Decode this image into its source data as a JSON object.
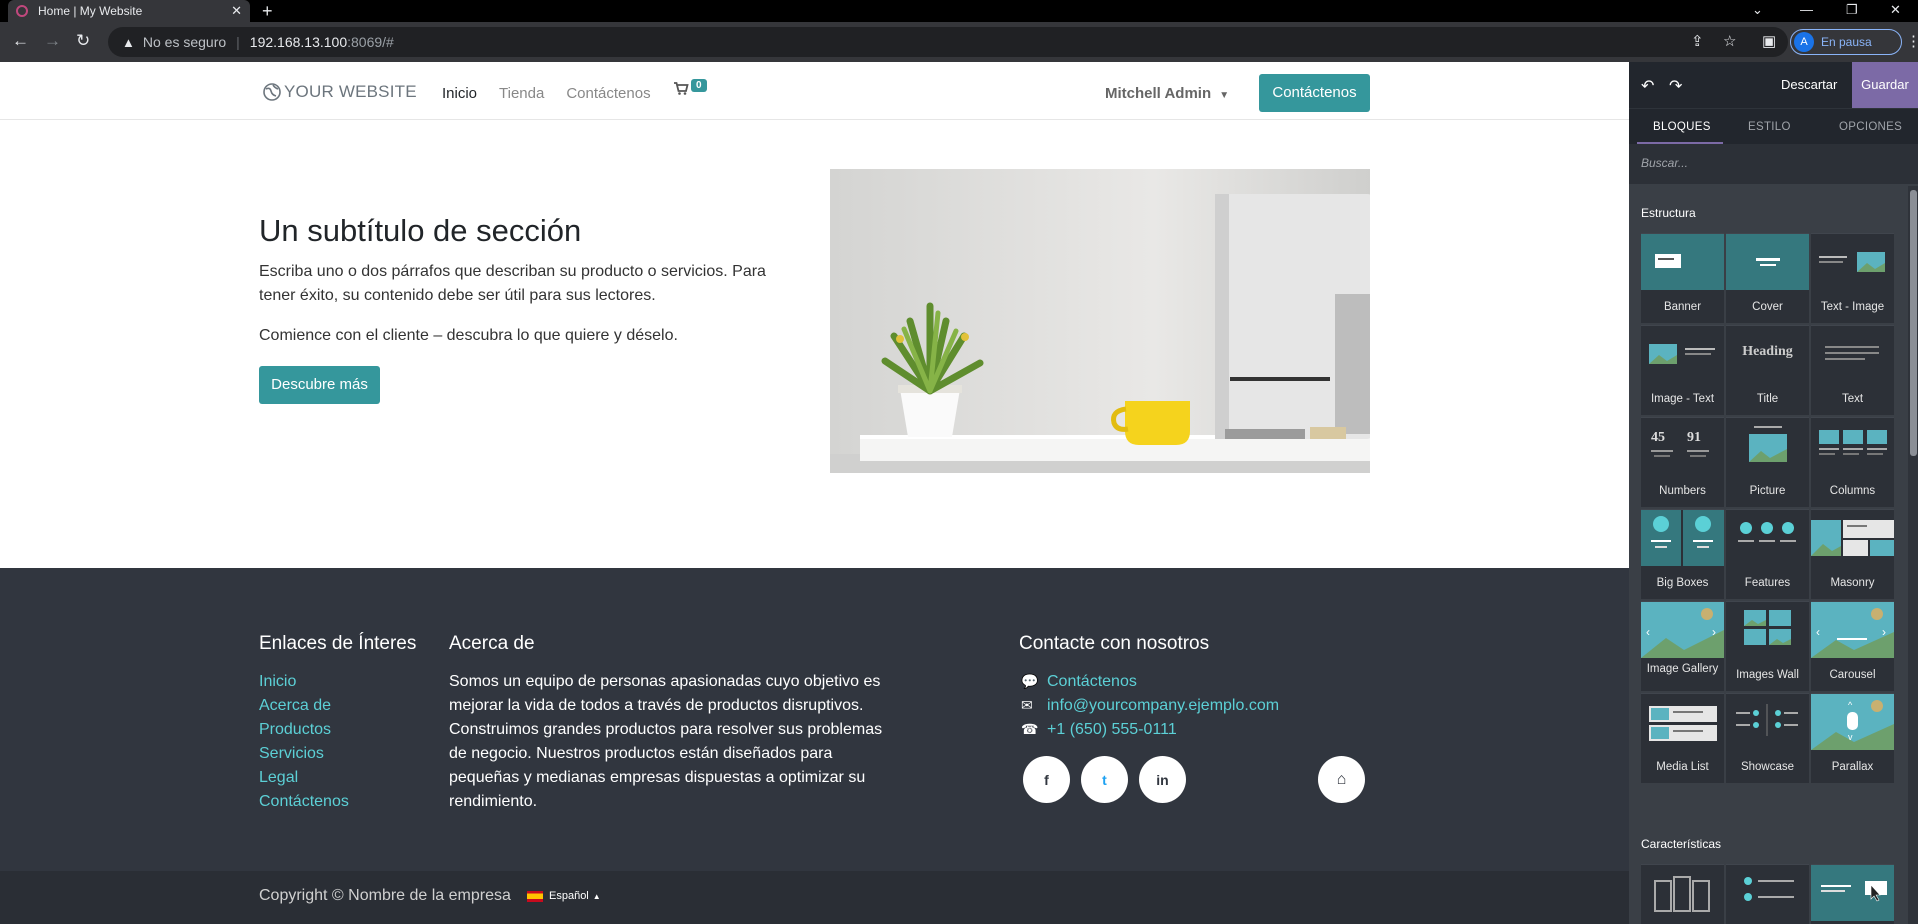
{
  "browser": {
    "tab_title": "Home | My Website",
    "tab_close": "✕",
    "new_tab": "+",
    "not_secure": "No es seguro",
    "url_host": "192.168.13.100",
    "url_path": ":8069/#",
    "profile_initial": "A",
    "profile_status": "En pausa"
  },
  "site": {
    "logo": "YOUR WEBSITE",
    "menu": [
      "Inicio",
      "Tienda",
      "Contáctenos"
    ],
    "cart_count": "0",
    "user": "Mitchell Admin",
    "header_button": "Contáctenos",
    "hero": {
      "title": "Un subtítulo de sección",
      "p1": "Escriba uno o dos párrafos que describan su producto o servicios. Para tener éxito, su contenido debe ser útil para sus lectores.",
      "p2": "Comience con el cliente – descubra lo que quiere y déselo.",
      "button": "Descubre más"
    },
    "footer": {
      "links_title": "Enlaces de Ínteres",
      "links": [
        "Inicio",
        "Acerca de",
        "Productos",
        "Servicios",
        "Legal",
        "Contáctenos"
      ],
      "about_title": "Acerca de",
      "about_text": "Somos un equipo de personas apasionadas cuyo objetivo es mejorar la vida de todos a través de productos disruptivos. Construimos grandes productos para resolver sus problemas de negocio. Nuestros productos están diseñados para pequeñas y medianas empresas dispuestas a optimizar su rendimiento.",
      "contact_title": "Contacte con nosotros",
      "contact_link": "Contáctenos",
      "email": "info@yourcompany.ejemplo.com",
      "phone": "+1 (650) 555-0111",
      "social": [
        "f",
        "t",
        "in"
      ]
    },
    "copyright": "Copyright © Nombre de la empresa",
    "language": "Español"
  },
  "editor": {
    "discard": "Descartar",
    "save": "Guardar",
    "tabs": [
      "BLOQUES",
      "ESTILO",
      "OPCIONES"
    ],
    "search_placeholder": "Buscar...",
    "section_structure": "Estructura",
    "blocks": [
      "Banner",
      "Cover",
      "Text - Image",
      "Image - Text",
      "Title",
      "Text",
      "Numbers",
      "Picture",
      "Columns",
      "Big Boxes",
      "Features",
      "Masonry",
      "Image Gallery",
      "Images Wall",
      "Carousel",
      "Media List",
      "Showcase",
      "Parallax"
    ],
    "title_thumb_text": "Heading",
    "numbers_thumb": [
      "45",
      "91"
    ],
    "section_features": "Características",
    "colors": {
      "accent": "#35979c",
      "save": "#7c6aa6",
      "panel": "#3a3f46",
      "footer": "#31363f"
    }
  }
}
